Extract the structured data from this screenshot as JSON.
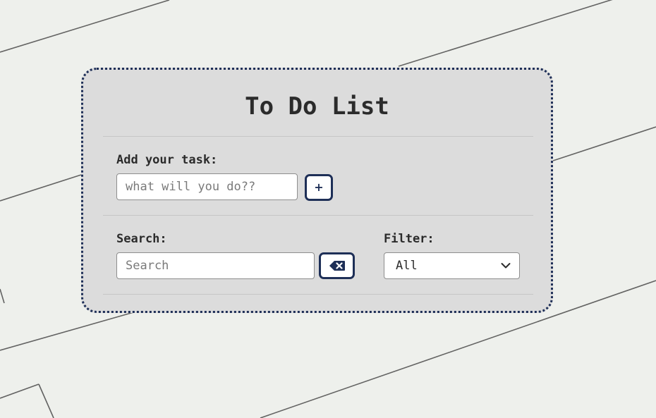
{
  "app": {
    "title": "To Do List"
  },
  "add_task": {
    "label": "Add your task:",
    "input_value": "",
    "input_placeholder": "what will you do??",
    "add_button_label": "+",
    "add_button_icon": "plus-icon"
  },
  "search": {
    "label": "Search:",
    "input_value": "",
    "input_placeholder": "Search",
    "clear_button_icon": "backspace-icon"
  },
  "filter": {
    "label": "Filter:",
    "selected": "All",
    "dropdown_icon": "chevron-down-icon"
  },
  "colors": {
    "accent": "#1e2f57",
    "card_background": "#dcdcdc",
    "page_background": "#eef0ec"
  }
}
